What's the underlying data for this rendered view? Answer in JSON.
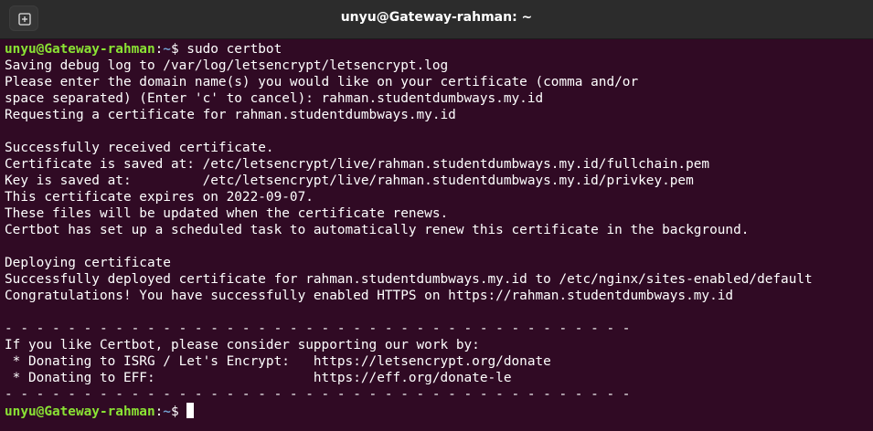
{
  "window": {
    "title": "unyu@Gateway-rahman: ~",
    "new_tab_icon": "new-tab-icon"
  },
  "colors": {
    "background": "#300a24",
    "prompt_user": "#8ae234",
    "prompt_path": "#729fcf",
    "text": "#ffffff"
  },
  "prompt": {
    "user_host": "unyu@Gateway-rahman",
    "separator": ":",
    "path": "~",
    "symbol": "$ "
  },
  "command": "sudo certbot",
  "output": [
    "Saving debug log to /var/log/letsencrypt/letsencrypt.log",
    "Please enter the domain name(s) you would like on your certificate (comma and/or",
    "space separated) (Enter 'c' to cancel): rahman.studentdumbways.my.id",
    "Requesting a certificate for rahman.studentdumbways.my.id",
    "",
    "Successfully received certificate.",
    "Certificate is saved at: /etc/letsencrypt/live/rahman.studentdumbways.my.id/fullchain.pem",
    "Key is saved at:         /etc/letsencrypt/live/rahman.studentdumbways.my.id/privkey.pem",
    "This certificate expires on 2022-09-07.",
    "These files will be updated when the certificate renews.",
    "Certbot has set up a scheduled task to automatically renew this certificate in the background.",
    "",
    "Deploying certificate",
    "Successfully deployed certificate for rahman.studentdumbways.my.id to /etc/nginx/sites-enabled/default",
    "Congratulations! You have successfully enabled HTTPS on https://rahman.studentdumbways.my.id",
    "",
    "- - - - - - - - - - - - - - - - - - - - - - - - - - - - - - - - - - - - - - - -",
    "If you like Certbot, please consider supporting our work by:",
    " * Donating to ISRG / Let's Encrypt:   https://letsencrypt.org/donate",
    " * Donating to EFF:                    https://eff.org/donate-le",
    "- - - - - - - - - - - - - - - - - - - - - - - - - - - - - - - - - - - - - - - -"
  ]
}
